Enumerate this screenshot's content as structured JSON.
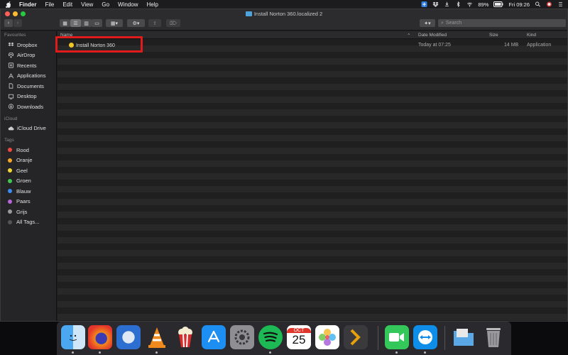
{
  "menubar": {
    "app": "Finder",
    "items": [
      "File",
      "Edit",
      "View",
      "Go",
      "Window",
      "Help"
    ],
    "battery": "89%",
    "clock": "Fri 09:26"
  },
  "window": {
    "title": "Install Norton 360.localized 2",
    "search_placeholder": "Search"
  },
  "sidebar": {
    "favourites_header": "Favourites",
    "favourites": [
      {
        "label": "Dropbox",
        "icon": "dropbox-icon"
      },
      {
        "label": "AirDrop",
        "icon": "airdrop-icon"
      },
      {
        "label": "Recents",
        "icon": "recents-icon"
      },
      {
        "label": "Applications",
        "icon": "applications-icon"
      },
      {
        "label": "Documents",
        "icon": "documents-icon"
      },
      {
        "label": "Desktop",
        "icon": "desktop-icon"
      },
      {
        "label": "Downloads",
        "icon": "downloads-icon"
      }
    ],
    "icloud_header": "iCloud",
    "icloud": [
      {
        "label": "iCloud Drive",
        "icon": "cloud-icon"
      }
    ],
    "tags_header": "Tags",
    "tags": [
      {
        "label": "Rood",
        "color": "#f1493f"
      },
      {
        "label": "Oranje",
        "color": "#f5a623"
      },
      {
        "label": "Geel",
        "color": "#f2d633"
      },
      {
        "label": "Groen",
        "color": "#3ec94e"
      },
      {
        "label": "Blauw",
        "color": "#3b8cf5"
      },
      {
        "label": "Paars",
        "color": "#b865d8"
      },
      {
        "label": "Grijs",
        "color": "#9a9a9a"
      },
      {
        "label": "All Tags...",
        "color": "#555555"
      }
    ]
  },
  "filelist": {
    "columns": {
      "name": "Name",
      "date": "Date Modified",
      "size": "Size",
      "kind": "Kind"
    },
    "rows": [
      {
        "name": "Install Norton 360",
        "date": "Today at 07:25",
        "size": "14 MB",
        "kind": "Application"
      }
    ]
  },
  "dock": {
    "calendar_month": "OCT",
    "calendar_day": "25"
  }
}
